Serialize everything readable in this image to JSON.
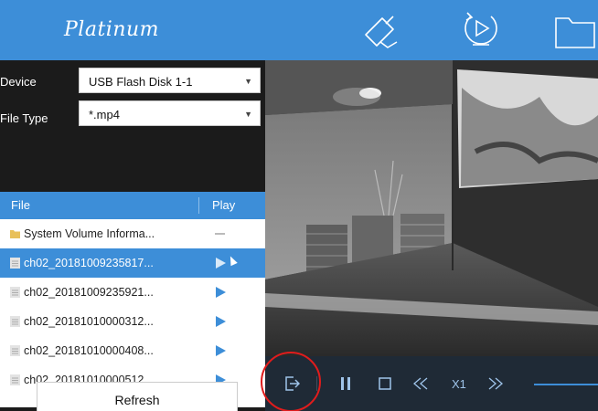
{
  "header": {
    "brand": "Platinum",
    "icons": [
      "camera-icon",
      "playback-icon",
      "folder-icon"
    ],
    "color": "#3d8ed8"
  },
  "sidebar": {
    "device_label": "Device",
    "device_value": "USB Flash Disk 1-1",
    "filetype_label": "File Type",
    "filetype_value": "*.mp4",
    "columns": {
      "file": "File",
      "play": "Play"
    },
    "files": [
      {
        "name": "System Volume Informa...",
        "type": "folder",
        "playable": false,
        "selected": false
      },
      {
        "name": "ch02_20181009235817...",
        "type": "file",
        "playable": true,
        "selected": true
      },
      {
        "name": "ch02_20181009235921...",
        "type": "file",
        "playable": true,
        "selected": false
      },
      {
        "name": "ch02_20181010000312...",
        "type": "file",
        "playable": true,
        "selected": false
      },
      {
        "name": "ch02_20181010000408...",
        "type": "file",
        "playable": true,
        "selected": false
      },
      {
        "name": "ch02_20181010000512...",
        "type": "file",
        "playable": true,
        "selected": false
      }
    ],
    "refresh_label": "Refresh"
  },
  "controls": {
    "speed_label": "X1",
    "icons": [
      "export-icon",
      "pause-icon",
      "stop-icon",
      "rewind-icon",
      "forward-icon"
    ],
    "highlight_color": "#e01c1c"
  }
}
